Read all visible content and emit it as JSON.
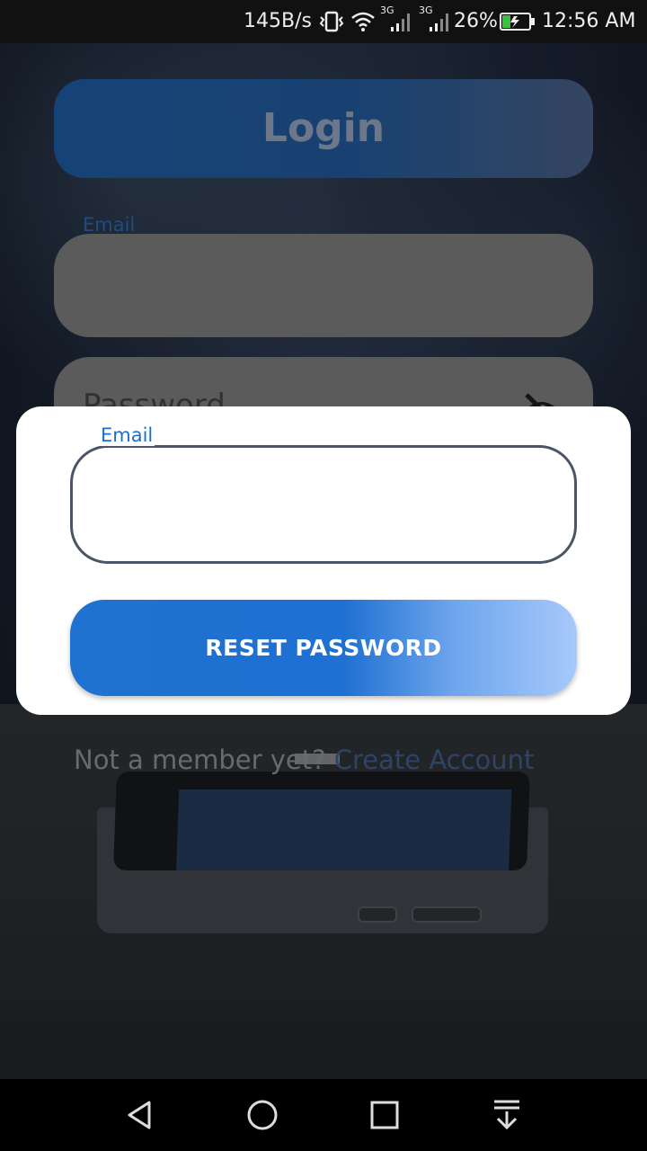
{
  "status_bar": {
    "net_speed": "145B/s",
    "network1": "3G",
    "network2": "3G",
    "battery": "26%",
    "time": "12:56 AM",
    "icons": [
      "vibrate-icon",
      "wifi-icon",
      "signal-icon",
      "signal-icon",
      "battery-charging-icon"
    ]
  },
  "login": {
    "title": "Login",
    "email_label": "Email",
    "password_placeholder": "Password",
    "footer_question": "Not a member yet?",
    "footer_link": "Create Account"
  },
  "dialog": {
    "email_label": "Email",
    "email_value": "",
    "reset_button": "RESET PASSWORD"
  },
  "nav_bar": {
    "icons": [
      "back-icon",
      "home-icon",
      "recents-icon",
      "notification-pull-icon"
    ]
  },
  "colors": {
    "accent": "#1f72d0",
    "label_blue": "#1f6fc8",
    "link": "#36507a"
  }
}
